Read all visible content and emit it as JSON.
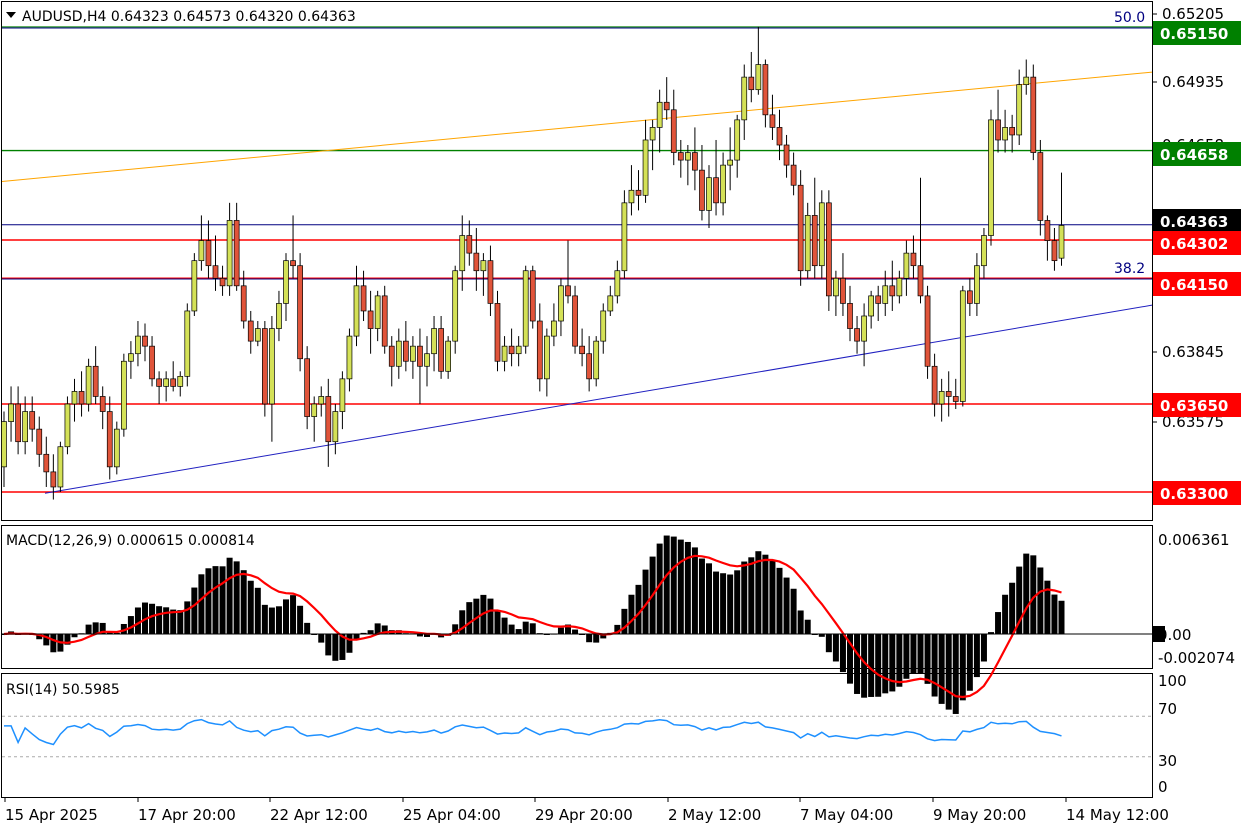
{
  "symbol_header": "AUDUSD,H4  0.64323 0.64573 0.64320 0.64363",
  "price_axis_ticks": [
    "0.65205",
    "0.64935",
    "0.64658",
    "0.64363",
    "0.64302",
    "0.64150",
    "0.63845",
    "0.63575",
    "0.63300"
  ],
  "level_tags": [
    {
      "text": "0.65150",
      "color": "#008000",
      "price": 0.6515
    },
    {
      "text": "0.64658",
      "color": "#008000",
      "price": 0.64658
    },
    {
      "text": "0.64363",
      "color": "#000000",
      "price": 0.64363
    },
    {
      "text": "0.64302",
      "color": "#ff0000",
      "price": 0.64302
    },
    {
      "text": "0.64150",
      "color": "#ff0000",
      "price": 0.6415
    },
    {
      "text": "0.63650",
      "color": "#ff0000",
      "price": 0.6365
    },
    {
      "text": "0.63300",
      "color": "#ff0000",
      "price": 0.633
    }
  ],
  "fib_labels": {
    "top": "50.0",
    "bottom": "38.2"
  },
  "time_labels": [
    "15 Apr 2025",
    "17 Apr 20:00",
    "22 Apr 12:00",
    "25 Apr 04:00",
    "29 Apr 20:00",
    "2 May 12:00",
    "7 May 04:00",
    "9 May 20:00",
    "14 May 12:00"
  ],
  "macd": {
    "label": "MACD(12,26,9) 0.000615 0.000814",
    "axis_top": "0.006361",
    "axis_zero": "0.00",
    "axis_bottom": "-0.002074"
  },
  "rsi": {
    "label": "RSI(14) 50.5985",
    "ticks": [
      "100",
      "70",
      "30",
      "0"
    ]
  },
  "colors": {
    "bull": "#d4e157",
    "bear": "#e0543a",
    "signal": "#ff0000",
    "rsi_line": "#1e90ff",
    "trend": "#2020c0",
    "channel": "#ffa500",
    "green_line": "#008000",
    "red_line": "#ff0000"
  },
  "chart_data": {
    "type": "candlestick",
    "symbol": "AUDUSD",
    "timeframe": "H4",
    "ylim": [
      0.6318,
      0.6522
    ],
    "candles": [
      [
        0.634,
        0.6362,
        0.6332,
        0.6358
      ],
      [
        0.6358,
        0.6372,
        0.635,
        0.6365
      ],
      [
        0.6365,
        0.6372,
        0.6345,
        0.635
      ],
      [
        0.635,
        0.6368,
        0.6345,
        0.6362
      ],
      [
        0.6362,
        0.6368,
        0.635,
        0.6355
      ],
      [
        0.6355,
        0.636,
        0.634,
        0.6345
      ],
      [
        0.6345,
        0.6352,
        0.6332,
        0.6338
      ],
      [
        0.6338,
        0.6345,
        0.6327,
        0.6332
      ],
      [
        0.6332,
        0.635,
        0.633,
        0.6348
      ],
      [
        0.6348,
        0.6368,
        0.6345,
        0.6365
      ],
      [
        0.6365,
        0.6375,
        0.6358,
        0.637
      ],
      [
        0.637,
        0.6378,
        0.636,
        0.6365
      ],
      [
        0.6365,
        0.6383,
        0.6362,
        0.638
      ],
      [
        0.638,
        0.6388,
        0.6365,
        0.6368
      ],
      [
        0.6368,
        0.6372,
        0.6355,
        0.6362
      ],
      [
        0.6362,
        0.6368,
        0.6335,
        0.634
      ],
      [
        0.634,
        0.6358,
        0.6337,
        0.6355
      ],
      [
        0.6355,
        0.6385,
        0.6352,
        0.6382
      ],
      [
        0.6382,
        0.639,
        0.6375,
        0.6385
      ],
      [
        0.6385,
        0.6398,
        0.638,
        0.6392
      ],
      [
        0.6392,
        0.6397,
        0.6382,
        0.6388
      ],
      [
        0.6388,
        0.6392,
        0.6372,
        0.6375
      ],
      [
        0.6375,
        0.6378,
        0.6365,
        0.6372
      ],
      [
        0.6372,
        0.6378,
        0.6366,
        0.6375
      ],
      [
        0.6375,
        0.6382,
        0.637,
        0.6372
      ],
      [
        0.6372,
        0.6378,
        0.6368,
        0.6376
      ],
      [
        0.6376,
        0.6405,
        0.6372,
        0.6402
      ],
      [
        0.6402,
        0.6425,
        0.64,
        0.6422
      ],
      [
        0.6422,
        0.644,
        0.6418,
        0.643
      ],
      [
        0.643,
        0.6438,
        0.6415,
        0.642
      ],
      [
        0.642,
        0.6432,
        0.641,
        0.6415
      ],
      [
        0.6415,
        0.642,
        0.6408,
        0.6412
      ],
      [
        0.6412,
        0.6445,
        0.6408,
        0.6438
      ],
      [
        0.6438,
        0.6445,
        0.641,
        0.6412
      ],
      [
        0.6412,
        0.6418,
        0.6395,
        0.6398
      ],
      [
        0.6398,
        0.6402,
        0.6385,
        0.639
      ],
      [
        0.639,
        0.6398,
        0.6388,
        0.6395
      ],
      [
        0.6395,
        0.6398,
        0.636,
        0.6365
      ],
      [
        0.6365,
        0.64,
        0.635,
        0.6395
      ],
      [
        0.6395,
        0.641,
        0.639,
        0.6405
      ],
      [
        0.6405,
        0.6425,
        0.6398,
        0.6422
      ],
      [
        0.6422,
        0.644,
        0.6415,
        0.642
      ],
      [
        0.642,
        0.6425,
        0.6378,
        0.6383
      ],
      [
        0.6383,
        0.6388,
        0.6355,
        0.636
      ],
      [
        0.636,
        0.6368,
        0.635,
        0.6365
      ],
      [
        0.6365,
        0.6372,
        0.636,
        0.6368
      ],
      [
        0.6368,
        0.6375,
        0.634,
        0.635
      ],
      [
        0.635,
        0.6365,
        0.6345,
        0.6362
      ],
      [
        0.6362,
        0.6378,
        0.6355,
        0.6375
      ],
      [
        0.6375,
        0.6395,
        0.637,
        0.6392
      ],
      [
        0.6392,
        0.642,
        0.6388,
        0.6412
      ],
      [
        0.6412,
        0.6418,
        0.6398,
        0.6402
      ],
      [
        0.6402,
        0.641,
        0.6385,
        0.6395
      ],
      [
        0.6395,
        0.641,
        0.639,
        0.6408
      ],
      [
        0.6408,
        0.6412,
        0.6385,
        0.6388
      ],
      [
        0.6388,
        0.6392,
        0.6372,
        0.638
      ],
      [
        0.638,
        0.6395,
        0.6375,
        0.639
      ],
      [
        0.639,
        0.6398,
        0.6378,
        0.6382
      ],
      [
        0.6382,
        0.6392,
        0.6375,
        0.6388
      ],
      [
        0.6388,
        0.6395,
        0.6365,
        0.638
      ],
      [
        0.638,
        0.6392,
        0.6372,
        0.6385
      ],
      [
        0.6385,
        0.64,
        0.6378,
        0.6395
      ],
      [
        0.6395,
        0.64,
        0.6375,
        0.6378
      ],
      [
        0.6378,
        0.6392,
        0.6375,
        0.639
      ],
      [
        0.639,
        0.642,
        0.6385,
        0.6418
      ],
      [
        0.6418,
        0.644,
        0.641,
        0.6432
      ],
      [
        0.6432,
        0.6438,
        0.642,
        0.6425
      ],
      [
        0.6425,
        0.6435,
        0.641,
        0.6418
      ],
      [
        0.6418,
        0.6425,
        0.6408,
        0.6422
      ],
      [
        0.6422,
        0.6428,
        0.64,
        0.6405
      ],
      [
        0.6405,
        0.641,
        0.6378,
        0.6382
      ],
      [
        0.6382,
        0.6392,
        0.6378,
        0.6388
      ],
      [
        0.6388,
        0.6395,
        0.638,
        0.6385
      ],
      [
        0.6385,
        0.6392,
        0.638,
        0.6388
      ],
      [
        0.6388,
        0.642,
        0.6385,
        0.6418
      ],
      [
        0.6418,
        0.642,
        0.6395,
        0.6398
      ],
      [
        0.6398,
        0.6405,
        0.637,
        0.6375
      ],
      [
        0.6375,
        0.6395,
        0.6368,
        0.6392
      ],
      [
        0.6392,
        0.6405,
        0.6388,
        0.6398
      ],
      [
        0.6398,
        0.6415,
        0.6392,
        0.6412
      ],
      [
        0.6412,
        0.643,
        0.6405,
        0.6408
      ],
      [
        0.6408,
        0.6412,
        0.6385,
        0.6388
      ],
      [
        0.6388,
        0.6395,
        0.638,
        0.6385
      ],
      [
        0.6385,
        0.6392,
        0.637,
        0.6375
      ],
      [
        0.6375,
        0.6392,
        0.6372,
        0.639
      ],
      [
        0.639,
        0.6405,
        0.6385,
        0.6402
      ],
      [
        0.6402,
        0.6412,
        0.64,
        0.6408
      ],
      [
        0.6408,
        0.6422,
        0.6405,
        0.6418
      ],
      [
        0.6418,
        0.645,
        0.6415,
        0.6445
      ],
      [
        0.6445,
        0.646,
        0.644,
        0.645
      ],
      [
        0.645,
        0.6458,
        0.6442,
        0.6448
      ],
      [
        0.6448,
        0.6478,
        0.6445,
        0.647
      ],
      [
        0.647,
        0.6478,
        0.6458,
        0.6475
      ],
      [
        0.6475,
        0.649,
        0.6465,
        0.6485
      ],
      [
        0.6485,
        0.6495,
        0.6478,
        0.6482
      ],
      [
        0.6482,
        0.649,
        0.646,
        0.6465
      ],
      [
        0.6465,
        0.647,
        0.6455,
        0.6462
      ],
      [
        0.6462,
        0.6468,
        0.6452,
        0.6465
      ],
      [
        0.6465,
        0.6475,
        0.645,
        0.6458
      ],
      [
        0.6458,
        0.6468,
        0.6438,
        0.6442
      ],
      [
        0.6442,
        0.646,
        0.6435,
        0.6455
      ],
      [
        0.6455,
        0.647,
        0.644,
        0.6445
      ],
      [
        0.6445,
        0.6465,
        0.644,
        0.646
      ],
      [
        0.646,
        0.6475,
        0.645,
        0.6462
      ],
      [
        0.6462,
        0.648,
        0.6455,
        0.6478
      ],
      [
        0.6478,
        0.65,
        0.647,
        0.6495
      ],
      [
        0.6495,
        0.6505,
        0.6485,
        0.649
      ],
      [
        0.649,
        0.6515,
        0.6488,
        0.65
      ],
      [
        0.65,
        0.6502,
        0.6475,
        0.648
      ],
      [
        0.648,
        0.6488,
        0.647,
        0.6475
      ],
      [
        0.6475,
        0.6482,
        0.6462,
        0.6468
      ],
      [
        0.6468,
        0.6472,
        0.6455,
        0.646
      ],
      [
        0.646,
        0.6465,
        0.6448,
        0.6452
      ],
      [
        0.6452,
        0.6458,
        0.6412,
        0.6418
      ],
      [
        0.6418,
        0.6445,
        0.6415,
        0.644
      ],
      [
        0.644,
        0.6455,
        0.6415,
        0.642
      ],
      [
        0.642,
        0.645,
        0.6415,
        0.6445
      ],
      [
        0.6445,
        0.645,
        0.6402,
        0.6408
      ],
      [
        0.6408,
        0.6418,
        0.64,
        0.6415
      ],
      [
        0.6415,
        0.6425,
        0.64,
        0.6405
      ],
      [
        0.6405,
        0.6412,
        0.639,
        0.6395
      ],
      [
        0.6395,
        0.64,
        0.6385,
        0.639
      ],
      [
        0.639,
        0.6405,
        0.638,
        0.64
      ],
      [
        0.64,
        0.641,
        0.6395,
        0.6408
      ],
      [
        0.6408,
        0.6412,
        0.6398,
        0.6405
      ],
      [
        0.6405,
        0.6418,
        0.64,
        0.6412
      ],
      [
        0.6412,
        0.6422,
        0.6402,
        0.6408
      ],
      [
        0.6408,
        0.6418,
        0.6405,
        0.6415
      ],
      [
        0.6415,
        0.643,
        0.6408,
        0.6425
      ],
      [
        0.6425,
        0.6432,
        0.6415,
        0.642
      ],
      [
        0.642,
        0.6455,
        0.6405,
        0.6408
      ],
      [
        0.6408,
        0.6412,
        0.6375,
        0.638
      ],
      [
        0.638,
        0.6385,
        0.636,
        0.6365
      ],
      [
        0.6365,
        0.6375,
        0.6358,
        0.637
      ],
      [
        0.637,
        0.6378,
        0.636,
        0.6368
      ],
      [
        0.6368,
        0.6375,
        0.6363,
        0.6366
      ],
      [
        0.6366,
        0.6412,
        0.6364,
        0.641
      ],
      [
        0.641,
        0.6415,
        0.64,
        0.6405
      ],
      [
        0.6405,
        0.6425,
        0.64,
        0.642
      ],
      [
        0.642,
        0.6435,
        0.6415,
        0.6432
      ],
      [
        0.6432,
        0.6482,
        0.6428,
        0.6478
      ],
      [
        0.6478,
        0.649,
        0.6465,
        0.647
      ],
      [
        0.647,
        0.6482,
        0.6465,
        0.6475
      ],
      [
        0.6475,
        0.648,
        0.6465,
        0.6472
      ],
      [
        0.6472,
        0.6498,
        0.6468,
        0.6492
      ],
      [
        0.6492,
        0.6502,
        0.6488,
        0.6495
      ],
      [
        0.6495,
        0.65,
        0.6462,
        0.6465
      ],
      [
        0.6465,
        0.647,
        0.6432,
        0.6438
      ],
      [
        0.6438,
        0.644,
        0.6422,
        0.643
      ],
      [
        0.643,
        0.6435,
        0.6418,
        0.6422
      ],
      [
        0.6423,
        0.6457,
        0.642,
        0.6436
      ]
    ],
    "horizontal_levels": [
      0.6515,
      0.64658,
      0.64363,
      0.64302,
      0.6415,
      0.6365,
      0.633
    ],
    "trendlines": [
      {
        "name": "support",
        "from": [
          0,
          0.633
        ],
        "to": [
          154,
          0.6403
        ]
      },
      {
        "name": "channel",
        "from": [
          0,
          0.6463
        ],
        "to": [
          154,
          0.6497
        ]
      }
    ],
    "fibonacci": [
      {
        "level": "50.0",
        "price": 0.6518
      },
      {
        "level": "38.2",
        "price": 0.6414
      }
    ],
    "macd": {
      "params": "12,26,9",
      "main": 0.000615,
      "signal": 0.000814,
      "ylim": [
        -0.002074,
        0.006361
      ]
    },
    "rsi": {
      "period": 14,
      "value": 50.5985,
      "levels": [
        70,
        30
      ],
      "ylim": [
        0,
        100
      ]
    }
  }
}
